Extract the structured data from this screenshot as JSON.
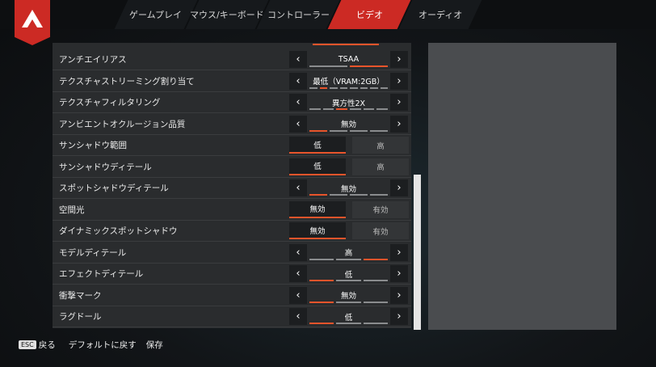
{
  "tabs": [
    "ゲームプレイ",
    "マウス/キーボード",
    "コントローラー",
    "ビデオ",
    "オーディオ"
  ],
  "active_tab": "ビデオ",
  "settings": [
    {
      "label": "アンチエイリアス",
      "type": "stepper",
      "value": "TSAA",
      "segments": [
        0,
        1
      ]
    },
    {
      "label": "テクスチャストリーミング割り当て",
      "type": "stepper",
      "value": "最低（VRAM:2GB）",
      "segments": [
        0,
        1,
        0,
        0,
        0,
        0,
        0,
        0
      ]
    },
    {
      "label": "テクスチャフィルタリング",
      "type": "stepper",
      "value": "異方性2X",
      "segments": [
        0,
        0,
        1,
        0,
        0,
        0
      ]
    },
    {
      "label": "アンビエントオクルージョン品質",
      "type": "stepper",
      "value": "無効",
      "segments": [
        1,
        0,
        0,
        0
      ]
    },
    {
      "label": "サンシャドウ範囲",
      "type": "toggle",
      "options": [
        "低",
        "高"
      ],
      "selected": 0
    },
    {
      "label": "サンシャドウディテール",
      "type": "toggle",
      "options": [
        "低",
        "高"
      ],
      "selected": 0
    },
    {
      "label": "スポットシャドウディテール",
      "type": "stepper",
      "value": "無効",
      "segments": [
        1,
        0,
        0,
        0
      ]
    },
    {
      "label": "空間光",
      "type": "toggle",
      "options": [
        "無効",
        "有効"
      ],
      "selected": 0
    },
    {
      "label": "ダイナミックスポットシャドウ",
      "type": "toggle",
      "options": [
        "無効",
        "有効"
      ],
      "selected": 0
    },
    {
      "label": "モデルディテール",
      "type": "stepper",
      "value": "高",
      "segments": [
        0,
        0,
        1
      ]
    },
    {
      "label": "エフェクトディテール",
      "type": "stepper",
      "value": "低",
      "segments": [
        1,
        0,
        0
      ]
    },
    {
      "label": "衝撃マーク",
      "type": "stepper",
      "value": "無効",
      "segments": [
        1,
        0,
        0
      ]
    },
    {
      "label": "ラグドール",
      "type": "stepper",
      "value": "低",
      "segments": [
        1,
        0,
        0
      ]
    }
  ],
  "footer": {
    "esc_key": "ESC",
    "back": "戻る",
    "reset": "デフォルトに戻す",
    "save": "保存"
  },
  "colors": {
    "accent": "#cc2a24",
    "highlight": "#e8542b"
  }
}
